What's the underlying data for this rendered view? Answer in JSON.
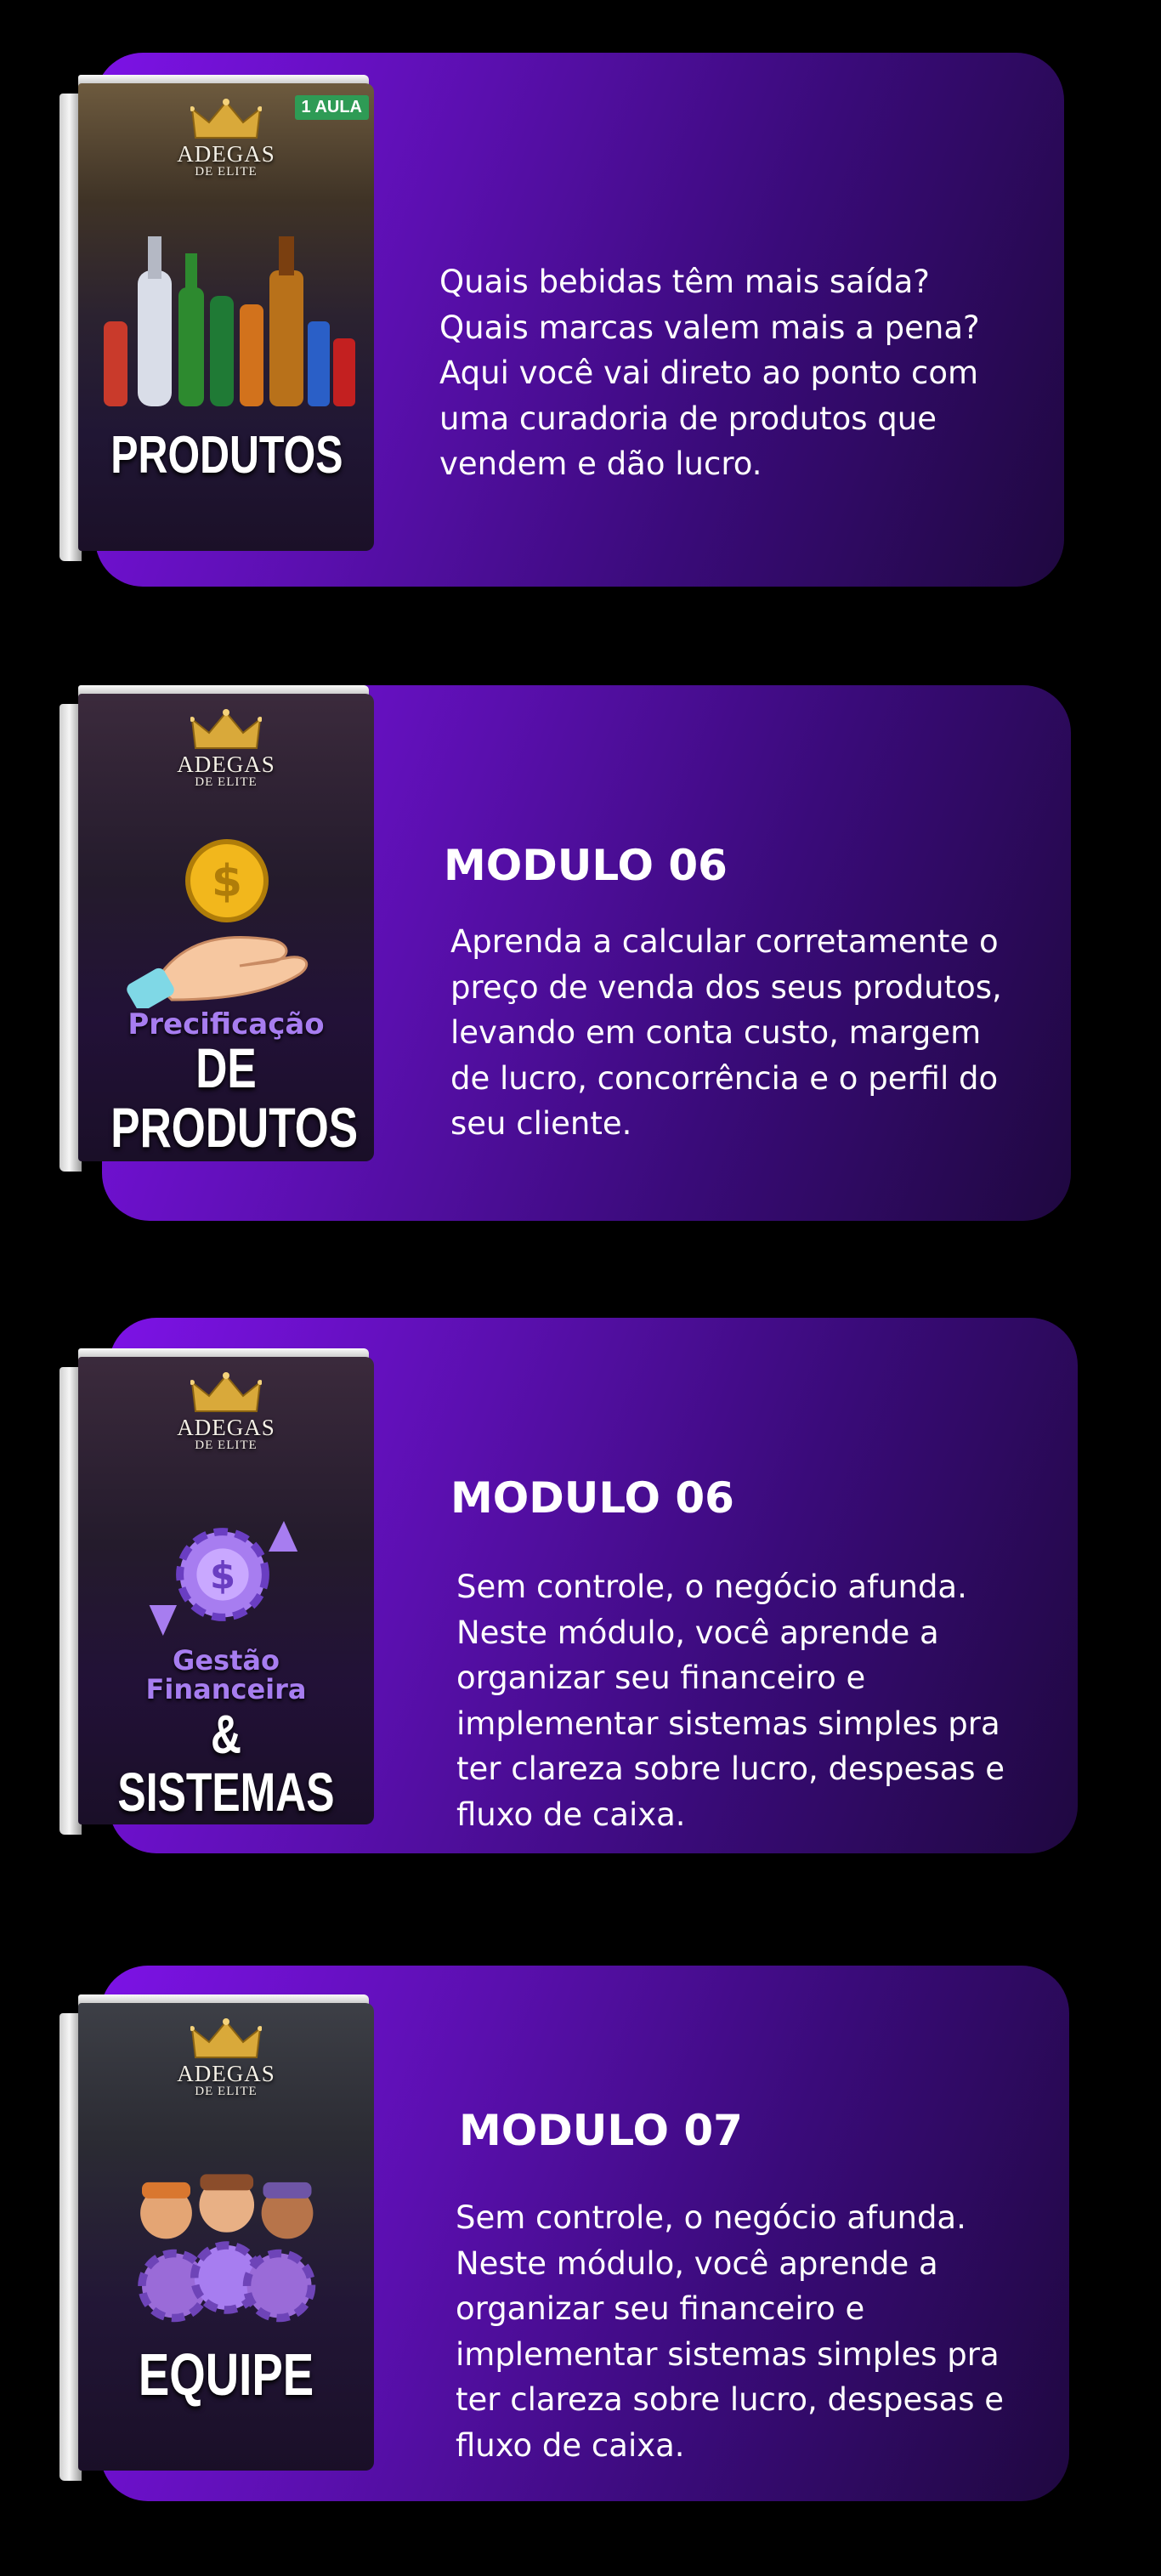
{
  "modules": [
    {
      "cover": {
        "badge": "1 AULA",
        "brand": "ADEGAS",
        "brand_sub": "DE ELITE",
        "subtitle": "",
        "title": "PRODUTOS",
        "image_icon": "beverage-bottles-icon"
      },
      "heading": "",
      "description": [
        "Quais bebidas têm mais saída?",
        "Quais marcas valem mais a pena?",
        "Aqui você vai direto ao ponto com",
        "uma curadoria de produtos que",
        "vendem e dão lucro."
      ]
    },
    {
      "cover": {
        "badge": "",
        "brand": "ADEGAS",
        "brand_sub": "DE ELITE",
        "subtitle": "Precificação",
        "title": "DE PRODUTOS",
        "image_icon": "coin-hand-icon"
      },
      "heading": "MODULO 06",
      "description": [
        "Aprenda a calcular corretamente o",
        "preço de venda dos seus produtos,",
        "levando em conta custo, margem",
        "de lucro, concorrência e o perfil do",
        "seu cliente."
      ]
    },
    {
      "cover": {
        "badge": "",
        "brand": "ADEGAS",
        "brand_sub": "DE ELITE",
        "subtitle": "Gestão Financeira",
        "title": "& SISTEMAS",
        "image_icon": "money-gear-icon"
      },
      "heading": "MODULO 06",
      "description": [
        "Sem controle, o negócio afunda.",
        "Neste módulo, você aprende a",
        "organizar seu financeiro e",
        "implementar sistemas simples pra",
        "ter clareza sobre lucro, despesas e",
        "fluxo de caixa."
      ]
    },
    {
      "cover": {
        "badge": "",
        "brand": "ADEGAS",
        "brand_sub": "DE ELITE",
        "subtitle": "",
        "title": "EQUIPE",
        "image_icon": "team-gears-icon"
      },
      "heading": "MODULO 07",
      "description": [
        "Sem controle, o negócio afunda.",
        "Neste módulo, você aprende a",
        "organizar seu financeiro e",
        "implementar sistemas simples pra",
        "ter clareza sobre lucro, despesas e",
        "fluxo de caixa."
      ]
    }
  ],
  "colors": {
    "background": "#000000",
    "card_gradient_start": "#7d12e6",
    "card_gradient_end": "#1f0840",
    "text": "#ffffff"
  }
}
